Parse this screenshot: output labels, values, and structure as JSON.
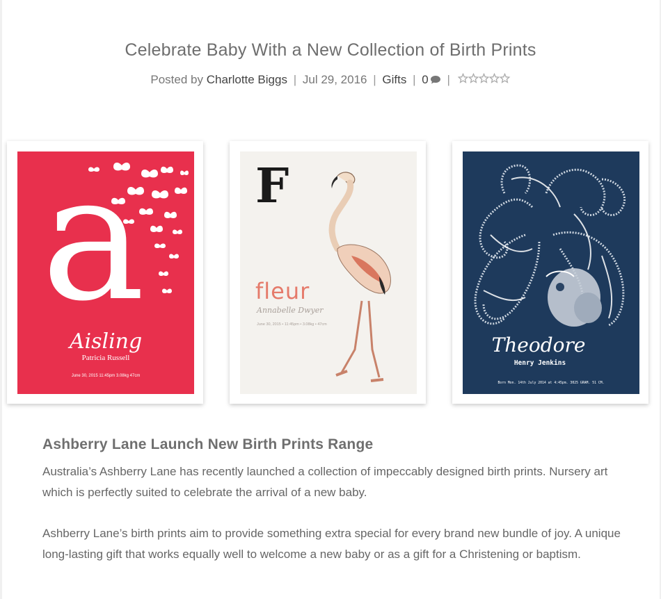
{
  "post": {
    "title": "Celebrate Baby With a New Collection of Birth Prints",
    "meta": {
      "posted_by_prefix": "Posted by",
      "author": "Charlotte Biggs",
      "date": "Jul 29, 2016",
      "category": "Gifts",
      "comment_count": "0",
      "separator": "|"
    },
    "rating": {
      "value": 0,
      "max": 5
    }
  },
  "prints": [
    {
      "letter": "a",
      "name": "Aisling",
      "subname": "Patricia Russell",
      "details": "June 30, 2015  11:45pm  3.08kg  47cm"
    },
    {
      "letter": "F",
      "name": "fleur",
      "subname": "Annabelle Dwyer",
      "details": "June 30, 2015 • 11:45pm • 3.08kg • 47cm"
    },
    {
      "name": "Theodore",
      "subname": "Henry Jenkins",
      "details": "Born Mon. 14th July 2014 at 4:45pm. 3025 GRAM. 51 CM."
    }
  ],
  "article": {
    "heading": "Ashberry Lane Launch New Birth Prints Range",
    "paragraphs": [
      "Australia’s Ashberry Lane has recently launched a collection of impeccably designed birth prints. Nursery art which is perfectly suited to celebrate the arrival of a new baby.",
      "Ashberry Lane’s birth prints aim to provide something extra special for every brand new bundle of joy. A unique long-lasting gift that works equally well to welcome a new baby or as a gift for a Christening or baptism."
    ]
  },
  "colors": {
    "print_red": "#e8304d",
    "print_cream": "#f4f2ee",
    "print_navy": "#1e3a5c",
    "flamingo_pink": "#e88a7a",
    "fleur_text": "#e57a6a"
  },
  "icons": [
    "comment-icon",
    "rating-stars-icon"
  ]
}
